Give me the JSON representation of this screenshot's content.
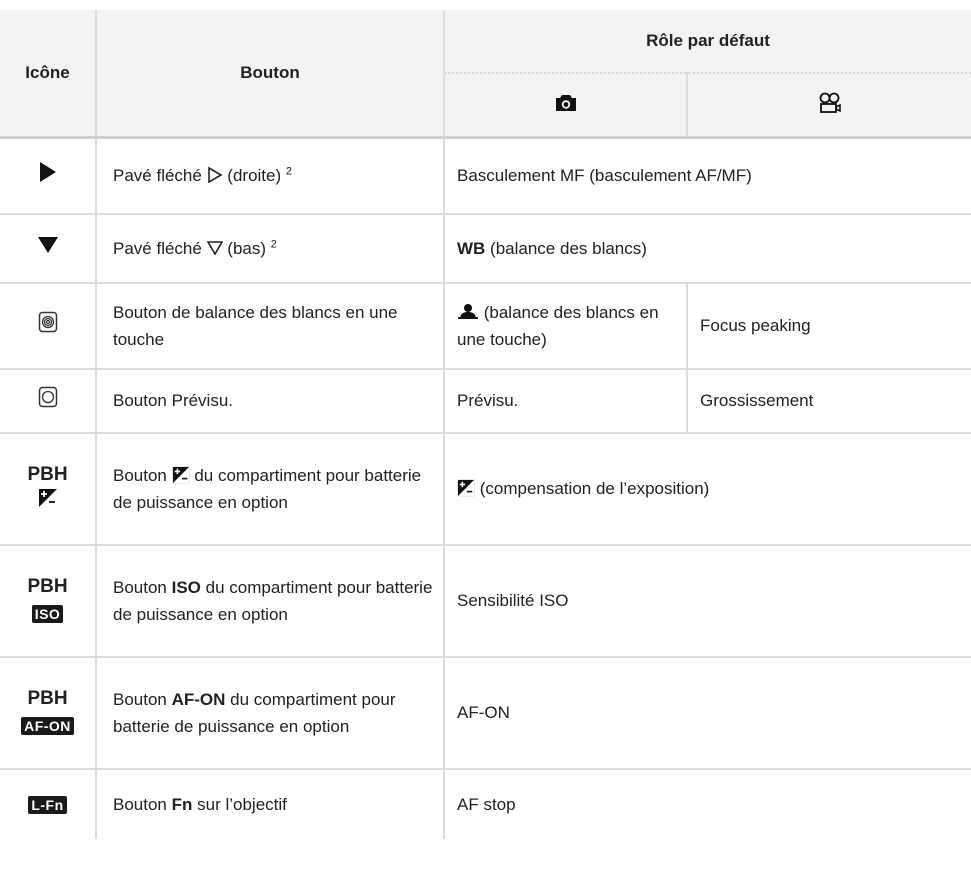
{
  "header": {
    "icon_col": "Icône",
    "button_col": "Bouton",
    "role_col": "Rôle par défaut"
  },
  "rows": [
    {
      "button": {
        "pre": "Pavé fléché ",
        "post": " (droite) ",
        "sup": "2"
      },
      "role": "Basculement MF (basculement AF/MF)"
    },
    {
      "button": {
        "pre": "Pavé fléché ",
        "post": " (bas) ",
        "sup": "2"
      },
      "role": {
        "bold": "WB",
        "rest": " (balance des blancs)"
      }
    },
    {
      "button": "Bouton de balance des blancs en une touche",
      "role_photo": " (balance des blancs en une touche)",
      "role_video": "Focus peaking"
    },
    {
      "button": "Bouton Prévisu.",
      "role_photo": "Prévisu.",
      "role_video": "Grossissement"
    },
    {
      "icon_label": "PBH",
      "button": {
        "pre": "Bouton ",
        "post": " du compartiment pour batterie de puissance en option"
      },
      "role": " (compensation de l’exposition)"
    },
    {
      "icon_label": "PBH",
      "icon_badge": "ISO",
      "button": {
        "pre": "Bouton ",
        "bold": "ISO",
        "post": " du compartiment pour batterie de puissance en option"
      },
      "role": "Sensibilité ISO"
    },
    {
      "icon_label": "PBH",
      "icon_badge": "AF-ON",
      "button": {
        "pre": "Bouton ",
        "bold": "AF-ON",
        "post": " du compartiment pour batterie de puissance en option"
      },
      "role": "AF-ON"
    },
    {
      "icon_badge": "L-Fn",
      "button": {
        "pre": "Bouton ",
        "bold": "Fn",
        "post": " sur l’objectif"
      },
      "role": "AF stop"
    }
  ],
  "icons": {
    "row0": "play-right-icon",
    "row1": "play-down-icon",
    "row2": "one-touch-wb-button-icon",
    "row3": "preview-button-icon",
    "row4": "exposure-compensation-icon",
    "photo": "camera-icon",
    "video": "movie-camera-icon"
  }
}
